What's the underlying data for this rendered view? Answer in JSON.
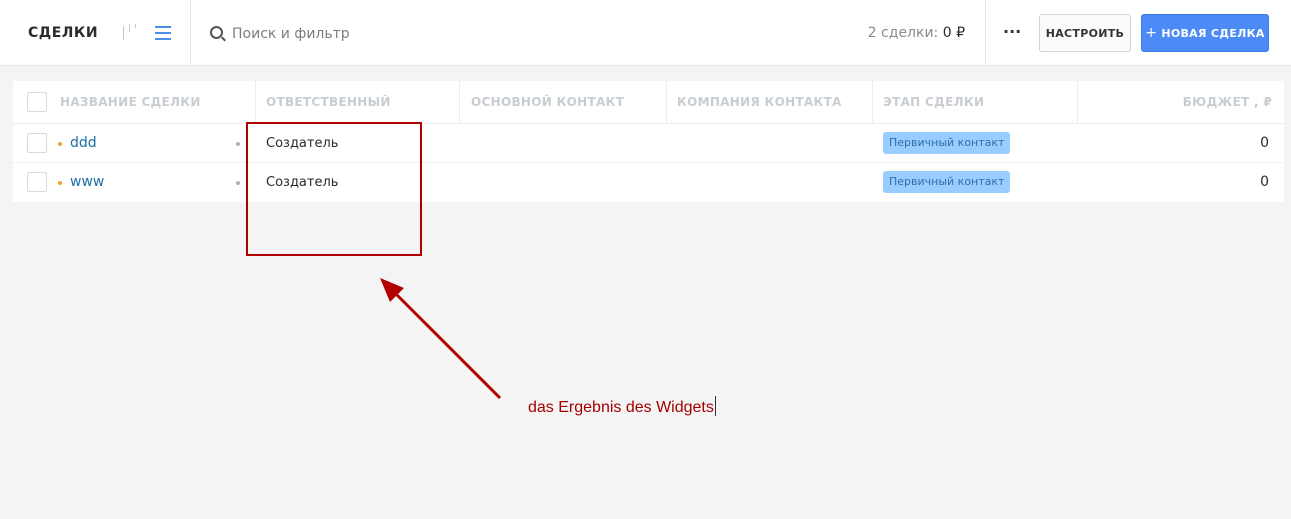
{
  "header": {
    "title": "СДЕЛКИ",
    "search_placeholder": "Поиск и фильтр",
    "summary_prefix": "2 сделки: ",
    "summary_value": "0 ₽",
    "more_label": "···",
    "configure_label": "НАСТРОИТЬ",
    "new_deal_label": "НОВАЯ СДЕЛКА"
  },
  "table": {
    "columns": [
      "НАЗВАНИЕ СДЕЛКИ",
      "ОТВЕТСТВЕННЫЙ",
      "ОСНОВНОЙ КОНТАКТ",
      "КОМПАНИЯ КОНТАКТА",
      "ЭТАП СДЕЛКИ",
      "БЮДЖЕТ , ₽"
    ],
    "rows": [
      {
        "name": "ddd",
        "responsible": "Создатель",
        "contact": "",
        "company": "",
        "stage": "Первичный контакт",
        "budget": "0"
      },
      {
        "name": "www",
        "responsible": "Создатель",
        "contact": "",
        "company": "",
        "stage": "Первичный контакт",
        "budget": "0"
      }
    ]
  },
  "colors": {
    "accent": "#4c8bf5",
    "stage_badge": "#99ccff",
    "annotation": "#b00000",
    "deal_dot": "#f0a330"
  },
  "annotation": {
    "text": "das Ergebnis des Widgets"
  }
}
